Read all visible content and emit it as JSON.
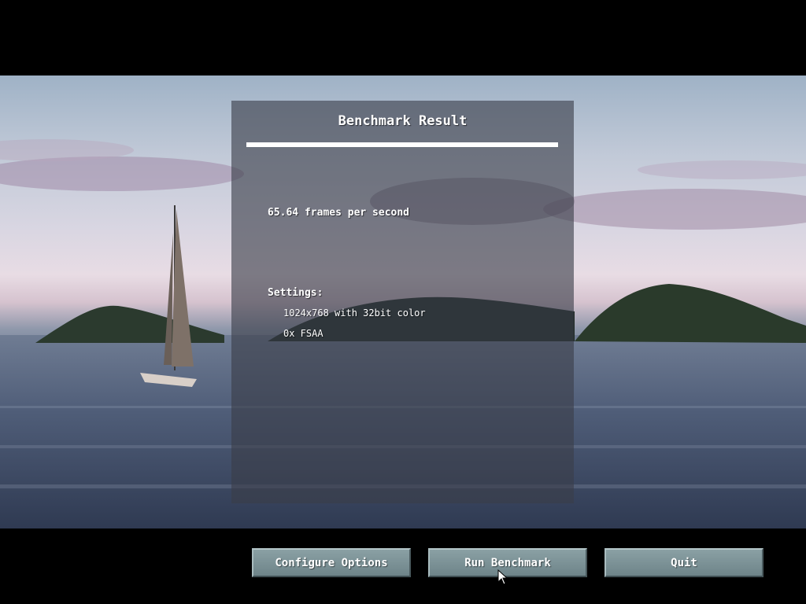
{
  "panel": {
    "title": "Benchmark Result",
    "fps": "65.64 frames per second",
    "settings_label": "Settings:",
    "resolution": "1024x768 with 32bit color",
    "fsaa": "0x FSAA"
  },
  "buttons": {
    "configure": "Configure Options",
    "run": "Run Benchmark",
    "quit": "Quit"
  },
  "colors": {
    "background": "#000000",
    "button": "#7a9095",
    "panel": "#3a3e48"
  }
}
